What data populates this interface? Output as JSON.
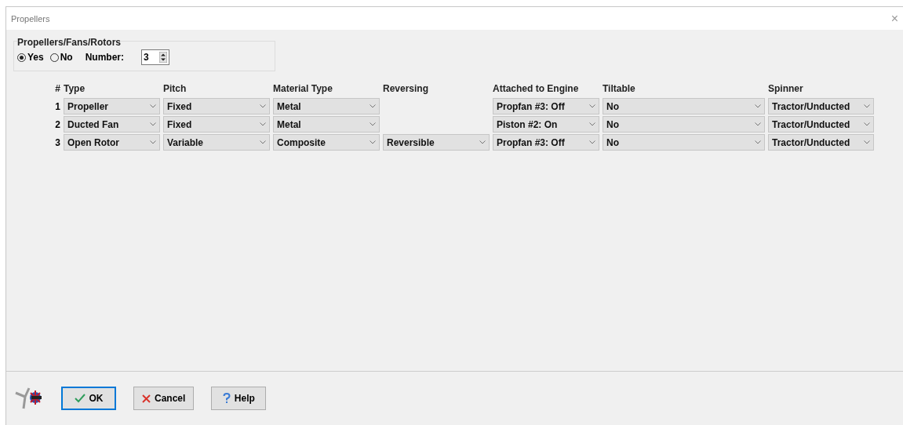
{
  "window": {
    "title": "Propellers",
    "close": "×"
  },
  "group": {
    "title": "Propellers/Fans/Rotors",
    "options": [
      {
        "label": "Yes",
        "selected": true
      },
      {
        "label": "No",
        "selected": false
      }
    ],
    "number_label": "Number:",
    "number_value": "3"
  },
  "table": {
    "columns": [
      "#",
      "Type",
      "Pitch",
      "Material Type",
      "Reversing",
      "Attached to Engine",
      "Tiltable",
      "Spinner"
    ],
    "rows": [
      {
        "cells": [
          "1",
          "Propeller",
          "Fixed",
          "Metal",
          null,
          "Propfan #3: Off",
          "No",
          "Tractor/Unducted"
        ]
      },
      {
        "cells": [
          "2",
          "Ducted Fan",
          "Fixed",
          "Metal",
          null,
          "Piston #2: On",
          "No",
          "Tractor/Unducted"
        ]
      },
      {
        "cells": [
          "3",
          "Open Rotor",
          "Variable",
          "Composite",
          "Reversible",
          "Propfan #3: Off",
          "No",
          "Tractor/Unducted"
        ]
      }
    ]
  },
  "buttons": [
    {
      "kind": "ok",
      "label": "OK",
      "focused": true
    },
    {
      "kind": "cancel",
      "label": "Cancel",
      "focused": false
    },
    {
      "kind": "help",
      "label": "Help",
      "focused": false
    }
  ]
}
